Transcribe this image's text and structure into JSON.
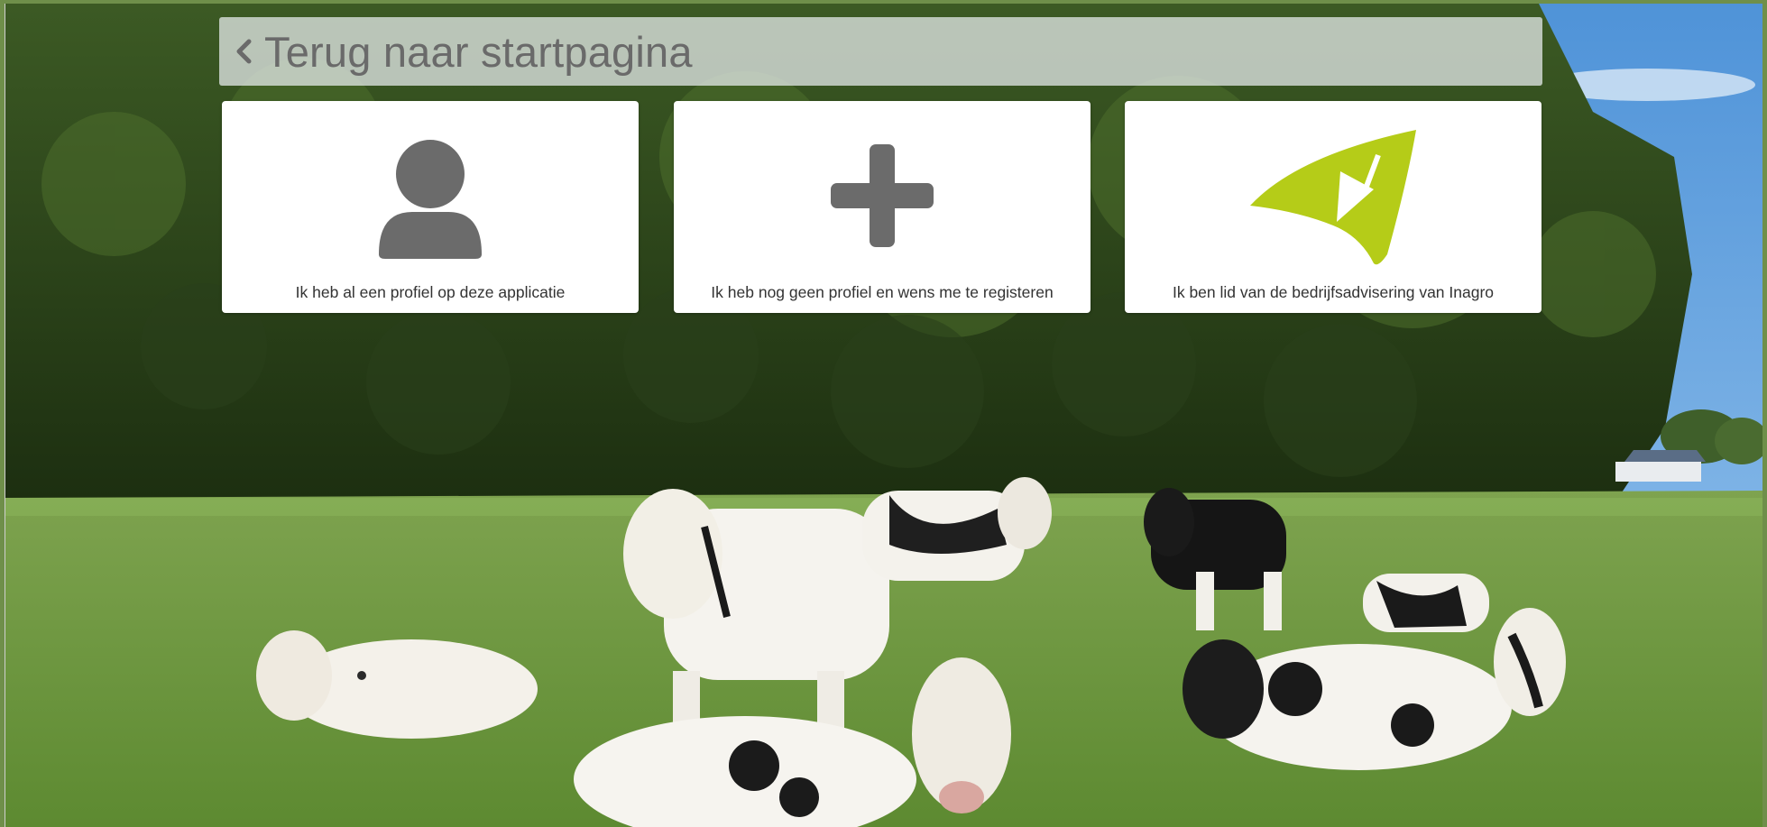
{
  "back_link": {
    "label": "Terug naar startpagina",
    "icon": "chevron-left-icon"
  },
  "options": [
    {
      "label": "Ik heb al een profiel op deze applicatie",
      "icon": "user-icon"
    },
    {
      "label": "Ik heb nog geen profiel en wens me te registeren",
      "icon": "plus-icon"
    },
    {
      "label": "Ik ben lid van de bedrijfsadvisering van Inagro",
      "icon": "inagro-logo-icon"
    }
  ],
  "background": {
    "subject": "cows-in-pasture",
    "icon": "background-photo"
  },
  "colors": {
    "icon_gray": "#6b6b6b",
    "inagro_green": "#b5cc18",
    "card_bg": "#ffffff",
    "caption_text": "#333333",
    "back_text": "#6a6a6a"
  }
}
